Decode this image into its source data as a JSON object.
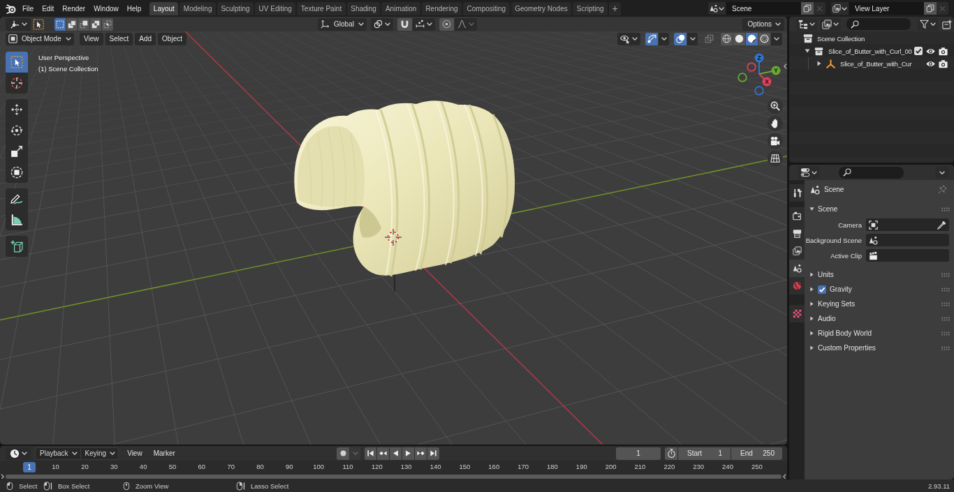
{
  "top_bar": {
    "menus": [
      "File",
      "Edit",
      "Render",
      "Window",
      "Help"
    ],
    "workspaces": [
      {
        "label": "Layout",
        "selected": true
      },
      {
        "label": "Modeling",
        "selected": false
      },
      {
        "label": "Sculpting",
        "selected": false
      },
      {
        "label": "UV Editing",
        "selected": false
      },
      {
        "label": "Texture Paint",
        "selected": false
      },
      {
        "label": "Shading",
        "selected": false
      },
      {
        "label": "Animation",
        "selected": false
      },
      {
        "label": "Rendering",
        "selected": false
      },
      {
        "label": "Compositing",
        "selected": false
      },
      {
        "label": "Geometry Nodes",
        "selected": false
      },
      {
        "label": "Scripting",
        "selected": false
      }
    ],
    "add_workspace": "+",
    "scene": "Scene",
    "view_layer": "View Layer"
  },
  "viewport": {
    "tool_header": {
      "select_modes": [
        {
          "kind": "set",
          "selected": true
        },
        {
          "kind": "extend",
          "selected": false
        },
        {
          "kind": "subtract",
          "selected": false
        },
        {
          "kind": "difference",
          "selected": false
        },
        {
          "kind": "intersect",
          "selected": false
        }
      ],
      "orientation": "Global",
      "options": "Options"
    },
    "header": {
      "mode": "Object Mode",
      "menus": [
        "View",
        "Select",
        "Add",
        "Object"
      ],
      "toggles": [
        {
          "kind": "gizmos",
          "on": true
        },
        {
          "kind": "overlays",
          "on": true
        },
        {
          "kind": "xray",
          "on": false
        }
      ],
      "shading": [
        {
          "kind": "wireframe",
          "selected": false
        },
        {
          "kind": "solid",
          "selected": false
        },
        {
          "kind": "material",
          "selected": true
        },
        {
          "kind": "rendered",
          "selected": false
        }
      ]
    },
    "view_info": [
      "User Perspective",
      "(1) Scene Collection"
    ],
    "toolbar_groups": [
      [
        {
          "kind": "select-box",
          "selected": true
        },
        {
          "kind": "cursor",
          "selected": false
        }
      ],
      [
        {
          "kind": "move",
          "selected": false
        },
        {
          "kind": "rotate",
          "selected": false
        },
        {
          "kind": "scale",
          "selected": false
        },
        {
          "kind": "transform",
          "selected": false
        }
      ],
      [
        {
          "kind": "annotate",
          "selected": false
        },
        {
          "kind": "measure",
          "selected": false
        }
      ],
      [
        {
          "kind": "add-cube",
          "selected": false
        }
      ]
    ],
    "gizmo_axes": [
      "Z",
      "Y",
      "X"
    ]
  },
  "outliner": {
    "root": "Scene Collection",
    "items": [
      {
        "label": "Slice_of_Butter_with_Curl_00",
        "kind": "collection",
        "expanded": true,
        "checked": true,
        "children": [
          {
            "label": "Slice_of_Butter_with_Cur",
            "kind": "empty",
            "expanded": false
          }
        ]
      }
    ]
  },
  "properties": {
    "tab_groups": [
      [
        {
          "kind": "tool",
          "selected": false
        }
      ],
      [
        {
          "kind": "render",
          "selected": false
        },
        {
          "kind": "output",
          "selected": false
        },
        {
          "kind": "view-layer",
          "selected": false
        },
        {
          "kind": "scene",
          "selected": true
        },
        {
          "kind": "world",
          "selected": false
        }
      ],
      [
        {
          "kind": "texture",
          "selected": false
        }
      ]
    ],
    "context": "Scene",
    "panels": [
      {
        "title": "Scene",
        "expanded": true,
        "fields": [
          {
            "label": "Camera",
            "kind": "camera"
          },
          {
            "label": "Background Scene",
            "kind": "scene"
          },
          {
            "label": "Active Clip",
            "kind": "clip"
          }
        ]
      },
      {
        "title": "Units",
        "expanded": false
      },
      {
        "title": "Gravity",
        "expanded": false,
        "checked": true
      },
      {
        "title": "Keying Sets",
        "expanded": false
      },
      {
        "title": "Audio",
        "expanded": false
      },
      {
        "title": "Rigid Body World",
        "expanded": false
      },
      {
        "title": "Custom Properties",
        "expanded": false
      }
    ]
  },
  "timeline": {
    "menus": [
      {
        "label": "Playback",
        "kind": "dropdown"
      },
      {
        "label": "Keying",
        "kind": "dropdown"
      },
      {
        "label": "View",
        "kind": "menu"
      },
      {
        "label": "Marker",
        "kind": "menu"
      }
    ],
    "auto_keying": false,
    "current_frame": "1",
    "start_label": "Start",
    "start": "1",
    "end_label": "End",
    "end": "250",
    "playhead": "1",
    "ruler": [
      "10",
      "20",
      "30",
      "40",
      "50",
      "60",
      "70",
      "80",
      "90",
      "100",
      "110",
      "120",
      "130",
      "140",
      "150",
      "160",
      "170",
      "180",
      "190",
      "200",
      "210",
      "220",
      "230",
      "240",
      "250"
    ]
  },
  "status_bar": {
    "hints": [
      {
        "kind": "click",
        "label": "Select"
      },
      {
        "kind": "drag",
        "label": "Box Select"
      },
      {
        "kind": "middle",
        "label": "Zoom View"
      },
      {
        "kind": "right-drag",
        "label": "Lasso Select"
      }
    ],
    "version": "2.93.11"
  }
}
